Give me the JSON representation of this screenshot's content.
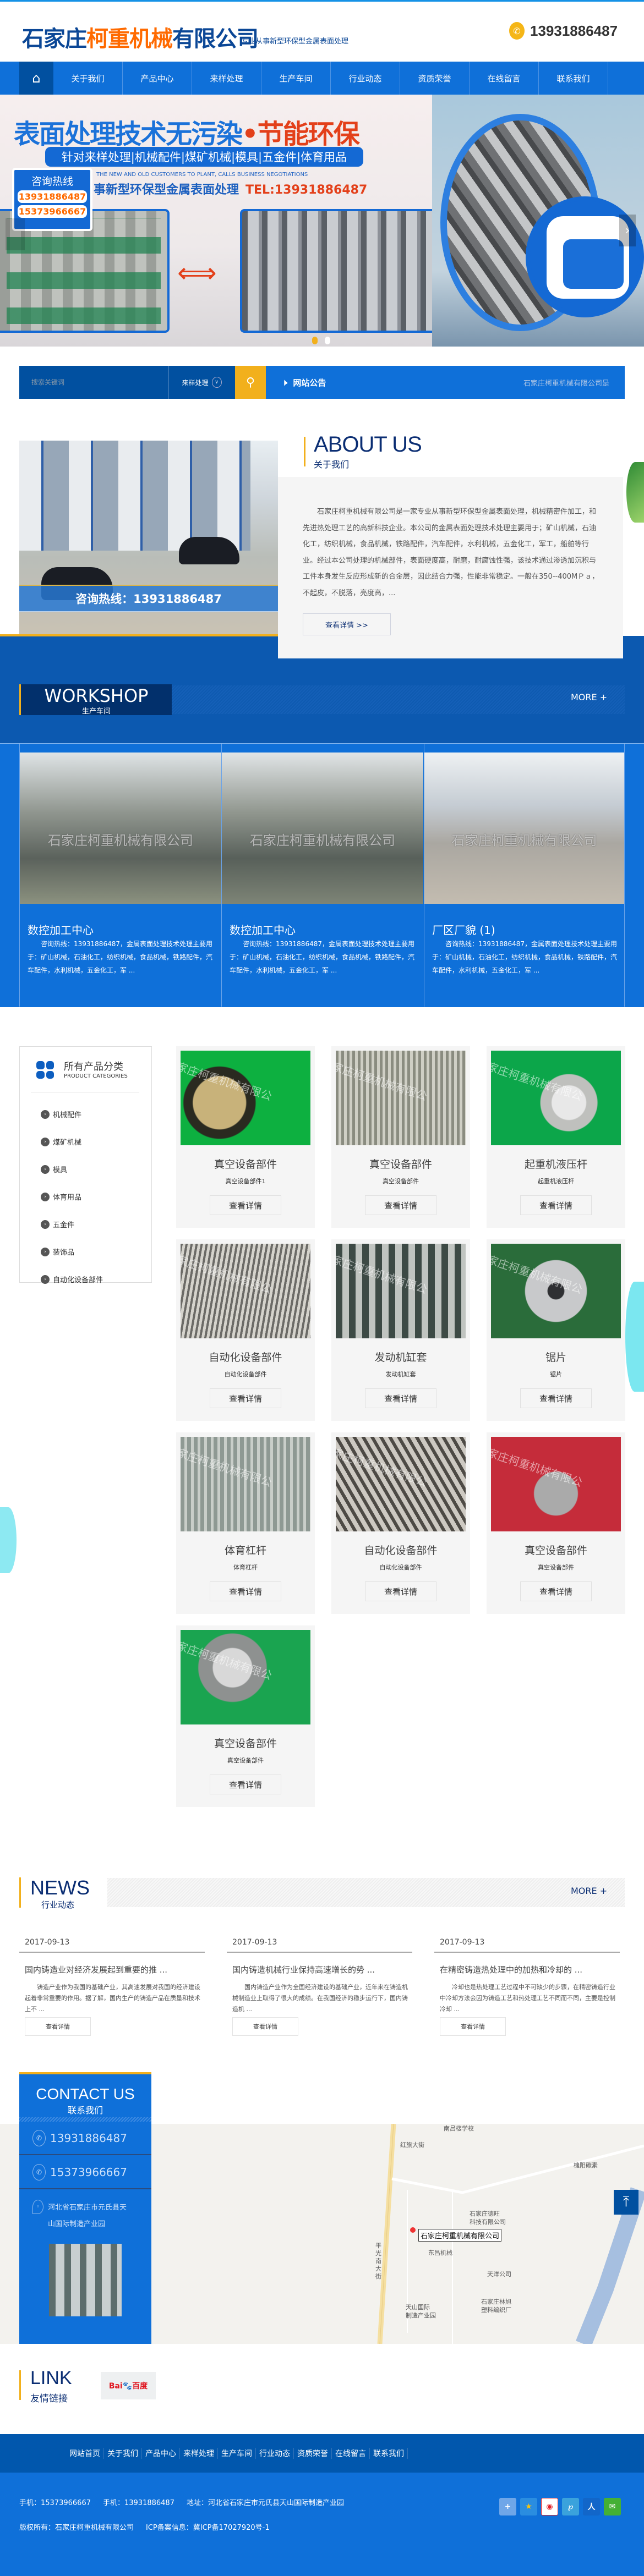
{
  "header": {
    "logo_pre": "石家庄",
    "logo_hl": "柯重机械",
    "logo_post": "有限公司",
    "tagline": "专业从事新型环保型金属表面处理",
    "phone": "13931886487",
    "phone_icon": "phone-icon"
  },
  "nav": {
    "home_icon": "home-icon",
    "items": [
      "关于我们",
      "产品中心",
      "来样处理",
      "生产车间",
      "行业动态",
      "资质荣誉",
      "在线留言",
      "联系我们"
    ]
  },
  "banner": {
    "headline_blue": "表面处理技术无污染",
    "headline_red": "•节能环保",
    "pill": "针对来样处理|机械配件|煤矿机械|模具|五金件|体育用品",
    "english": "THE NEW AND OLD CUSTOMERS TO PLANT, CALLS BUSINESS NEGOTIATIONS",
    "line2": "事新型环保型金属表面处理",
    "tel": "TEL:13931886487",
    "hotline_label": "咨询热线",
    "hotline_1": "13931886487",
    "hotline_2": "15373966667",
    "slides": 2,
    "active_slide": 1
  },
  "search": {
    "placeholder": "搜索关键词",
    "category": "来样处理",
    "notice_label": "网站公告",
    "notice_text": "石家庄柯重机械有限公司是"
  },
  "about": {
    "title": "ABOUT US",
    "subtitle": "关于我们",
    "image_caption": "咨询热线：13931886487",
    "text": "石家庄柯重机械有限公司是一家专业从事新型环保型金属表面处理，机械精密件加工，和先进热处理工艺的高新科技企业。本公司的金属表面处理技术处理主要用于；矿山机械，石油化工，纺织机械，食品机械，铁路配件，汽车配件，水利机械，五金化工，军工，船舶等行业。经过本公司处理的机械部件，表面硬度高，耐磨，耐腐蚀性强，该技术通过渗透加沉积与工件本身发生反应形成新的合金层，因此结合力强，性能非常稳定。一般在350--400MＰａ，不起皮，不脱落，亮度高，...",
    "button": "查看详情 >>"
  },
  "workshop": {
    "title": "WORKSHOP",
    "subtitle": "生产车间",
    "more": "MORE +",
    "watermark": "石家庄柯重机械有限公司",
    "items": [
      {
        "title": "数控加工中心",
        "text": "咨询热线：13931886487，金属表面处理技术处理主要用于：矿山机械，石油化工，纺织机械，食品机械，铁路配件，汽车配件，水利机械，五金化工，军 ..."
      },
      {
        "title": "数控加工中心",
        "text": "咨询热线：13931886487，金属表面处理技术处理主要用于：矿山机械，石油化工，纺织机械，食品机械，铁路配件，汽车配件，水利机械，五金化工，军 ..."
      },
      {
        "title": "厂区厂貌 (1)",
        "text": "咨询热线：13931886487，金属表面处理技术处理主要用于：矿山机械，石油化工，纺织机械，食品机械，铁路配件，汽车配件，水利机械，五金化工，军 ..."
      }
    ]
  },
  "products": {
    "sidebar_title": "所有产品分类",
    "sidebar_en": "PRODUCT CATEGORIES",
    "categories": [
      "机械配件",
      "煤矿机械",
      "模具",
      "体育用品",
      "五金件",
      "装饰品",
      "自动化设备部件"
    ],
    "watermark": "家庄柯重机械有限公",
    "button": "查看详情",
    "items": [
      {
        "name": "真空设备部件",
        "sub": "真空设备部件1"
      },
      {
        "name": "真空设备部件",
        "sub": "真空设备部件"
      },
      {
        "name": "起重机液压杆",
        "sub": "起重机液压杆"
      },
      {
        "name": "自动化设备部件",
        "sub": "自动化设备部件"
      },
      {
        "name": "发动机缸套",
        "sub": "发动机缸套"
      },
      {
        "name": "锯片",
        "sub": "锯片"
      },
      {
        "name": "体育杠杆",
        "sub": "体育杠杆"
      },
      {
        "name": "自动化设备部件",
        "sub": "自动化设备部件"
      },
      {
        "name": "真空设备部件",
        "sub": "真空设备部件"
      },
      {
        "name": "真空设备部件",
        "sub": "真空设备部件"
      }
    ]
  },
  "news": {
    "title": "NEWS",
    "subtitle": "行业动态",
    "more": "MORE +",
    "button": "查看详情",
    "items": [
      {
        "date": "2017-09-13",
        "title": "国内铸造业对经济发展起到重要的推 ...",
        "text": "铸造产业作为我国的基础产业，其高速发展对我国的经济建设起着非常重要的作用。据了解，国内生产的铸造产品在质量和技术上不 ..."
      },
      {
        "date": "2017-09-13",
        "title": "国内铸造机械行业保持高速增长的势 ...",
        "text": "国内铸造产业作为全国经济建设的基础产业，近年来在铸造机械制造业上取得了很大的成绩。在我国经济的稳步运行下，国内铸造机 ..."
      },
      {
        "date": "2017-09-13",
        "title": "在精密铸造热处理中的加热和冷却的 ...",
        "text": "冷却也是热处理工艺过程中不可缺少的步骤，在精密铸造行业中冷却方法会因为铸造工艺和热处理工艺不同而不同，主要是控制冷却 ..."
      }
    ]
  },
  "contact": {
    "title": "CONTACT US",
    "subtitle": "联系我们",
    "phone_1": "13931886487",
    "phone_2": "15373966667",
    "address_1": "河北省石家庄市元氏县天",
    "address_2": "山国际制造产业园"
  },
  "map": {
    "labels": [
      "南吕楼学校",
      "红旗大街",
      "槐阳碳素",
      "石家庄德旺",
      "科技有限公司",
      "东昌机械",
      "平光南大街",
      "天洋公司",
      "天山国际",
      "制造产业园",
      "石家庄林旭",
      "塑料编织厂"
    ],
    "marker": "石家庄柯重机械有限公司"
  },
  "links": {
    "title": "LINK",
    "subtitle": "友情链接",
    "baidu_logo": "Bai百度"
  },
  "footer": {
    "nav": [
      "网站首页",
      "关于我们",
      "产品中心",
      "来样处理",
      "生产车间",
      "行业动态",
      "资质荣誉",
      "在线留言",
      "联系我们"
    ],
    "mobile_1": "手机：15373966667",
    "mobile_2": "手机：13931886487",
    "address": "地址：河北省石家庄市元氏县天山国际制造产业园",
    "copyright": "版权所有：石家庄柯重机械有限公司",
    "icp": "ICP备案信息：冀ICP备17027920号-1",
    "share_icons": [
      "share-more-icon",
      "qzone-icon",
      "weibo-icon",
      "tencent-weibo-icon",
      "renren-icon",
      "wechat-icon"
    ]
  },
  "colors": {
    "brand_blue": "#0f70d9",
    "dark_blue": "#0150a0",
    "accent_yellow": "#f2b01c",
    "logo_orange": "#ff6a00",
    "title_navy": "#0b2e73"
  }
}
